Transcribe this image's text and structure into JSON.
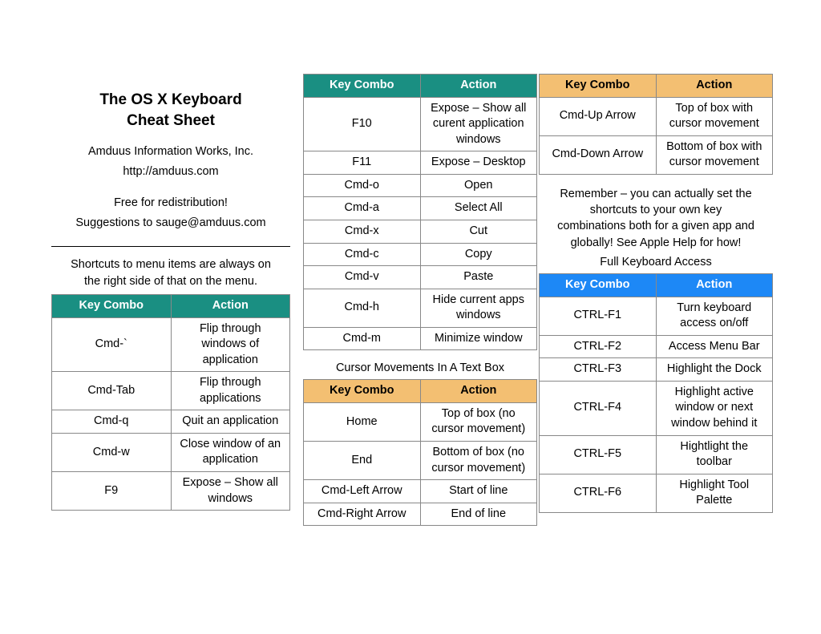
{
  "title_line1": "The OS X Keyboard",
  "title_line2": "Cheat Sheet",
  "publisher": "Amduus Information Works, Inc.",
  "url": "http://amduus.com",
  "redistrib": "Free for redistribution!",
  "suggestions": "Suggestions to sauge@amduus.com",
  "tip1a": "Shortcuts to menu items are always on",
  "tip1b": "the right side of that on the menu.",
  "headers": {
    "key": "Key Combo",
    "action": "Action"
  },
  "table_basic": [
    {
      "k": "Cmd-`",
      "a": "Flip through windows of application"
    },
    {
      "k": "Cmd-Tab",
      "a": "Flip through applications"
    },
    {
      "k": "Cmd-q",
      "a": "Quit an application"
    },
    {
      "k": "Cmd-w",
      "a": "Close window of an application"
    },
    {
      "k": "F9",
      "a": "Expose – Show all windows"
    }
  ],
  "table_more": [
    {
      "k": "F10",
      "a": "Expose – Show all curent application windows"
    },
    {
      "k": "F11",
      "a": "Expose – Desktop"
    },
    {
      "k": "Cmd-o",
      "a": "Open"
    },
    {
      "k": "Cmd-a",
      "a": "Select All"
    },
    {
      "k": "Cmd-x",
      "a": "Cut"
    },
    {
      "k": "Cmd-c",
      "a": "Copy"
    },
    {
      "k": "Cmd-v",
      "a": "Paste"
    },
    {
      "k": "Cmd-h",
      "a": "Hide current apps windows"
    },
    {
      "k": "Cmd-m",
      "a": "Minimize window"
    }
  ],
  "caption_cursor": "Cursor Movements In A Text Box",
  "table_cursor": [
    {
      "k": "Home",
      "a": "Top of box (no cursor movement)"
    },
    {
      "k": "End",
      "a": "Bottom of box (no cursor movement)"
    },
    {
      "k": "Cmd-Left Arrow",
      "a": "Start of line"
    },
    {
      "k": "Cmd-Right Arrow",
      "a": "End of line"
    }
  ],
  "table_cursor2": [
    {
      "k": "Cmd-Up Arrow",
      "a": "Top of box with cursor movement"
    },
    {
      "k": "Cmd-Down Arrow",
      "a": "Bottom of box with cursor movement"
    }
  ],
  "remember1": "Remember – you can actually set the",
  "remember2": "shortcuts to your own key",
  "remember3": "combinations both for a given app and",
  "remember4": "globally!  See Apple Help for how!",
  "caption_fka": "Full Keyboard Access",
  "table_fka": [
    {
      "k": "CTRL-F1",
      "a": "Turn keyboard access on/off"
    },
    {
      "k": "CTRL-F2",
      "a": "Access Menu Bar"
    },
    {
      "k": "CTRL-F3",
      "a": "Highlight the Dock"
    },
    {
      "k": "CTRL-F4",
      "a": "Highlight active window or next window behind it"
    },
    {
      "k": "CTRL-F5",
      "a": "Hightlight the toolbar"
    },
    {
      "k": "CTRL-F6",
      "a": "Highlight Tool Palette"
    }
  ]
}
